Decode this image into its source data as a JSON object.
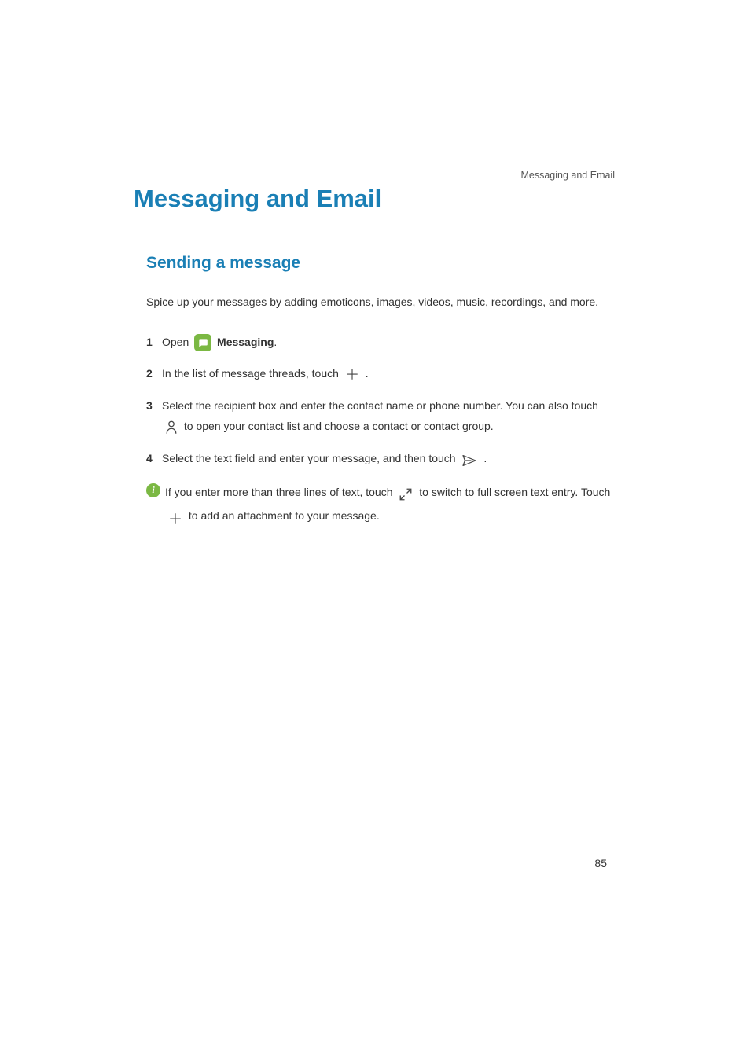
{
  "running_header": "Messaging and Email",
  "chapter_title": "Messaging and Email",
  "section_title": "Sending a message",
  "intro": "Spice up your messages by adding emoticons, images, videos, music, recordings, and more.",
  "steps": {
    "s1": {
      "num": "1",
      "open": "Open ",
      "app": "Messaging",
      "period": "."
    },
    "s2": {
      "num": "2",
      "before": "In the list of message threads, touch ",
      "after": "."
    },
    "s3": {
      "num": "3",
      "before": "Select the recipient box and enter the contact name or phone number. You can also touch ",
      "after": " to open your contact list and choose a contact or contact group."
    },
    "s4": {
      "num": "4",
      "before": "Select the text field and enter your message, and then touch ",
      "after": "."
    }
  },
  "info": {
    "before": "If you enter more than three lines of text, touch ",
    "mid": " to switch to full screen text entry. Touch ",
    "after": " to add an attachment to your message."
  },
  "page_number": "85"
}
